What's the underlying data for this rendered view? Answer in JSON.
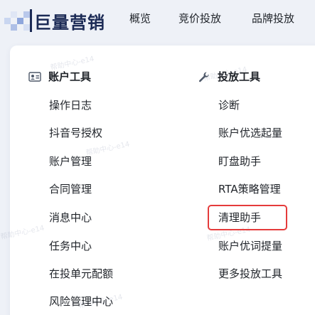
{
  "header": {
    "brand": "巨量营销",
    "nav": [
      "概览",
      "竞价投放",
      "品牌投放"
    ]
  },
  "menu": {
    "account_tools": {
      "title": "账户工具",
      "icon": "account-card-icon",
      "items": [
        "操作日志",
        "抖音号授权",
        "账户管理",
        "合同管理",
        "消息中心",
        "任务中心",
        "在投单元配额",
        "风险管理中心"
      ]
    },
    "delivery_tools": {
      "title": "投放工具",
      "icon": "wrench-icon",
      "items": [
        "诊断",
        "账户优选起量",
        "盯盘助手",
        "RTA策略管理",
        "清理助手",
        "账户优词提量",
        "更多投放工具"
      ]
    }
  },
  "highlighted_item": "清理助手",
  "watermark": "帮助中心-e14",
  "colors": {
    "brand_text": "#1b2a55",
    "highlight_border": "#e53b3b",
    "background": "#eef1f7"
  }
}
